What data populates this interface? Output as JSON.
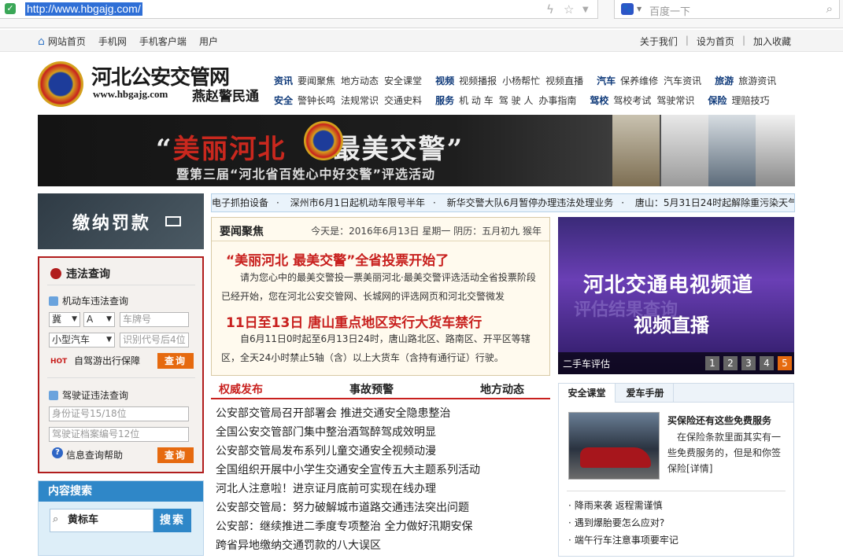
{
  "browser": {
    "url": "http://www.hbgajg.com/",
    "search_placeholder": "百度一下"
  },
  "topnav": {
    "left": [
      "网站首页",
      "手机网",
      "手机客户端",
      "用户"
    ],
    "right": [
      "关于我们",
      "设为首页",
      "加入收藏"
    ],
    "sep": "|"
  },
  "header": {
    "title": "河北公安交管网",
    "url": "www.hbgajg.com",
    "brand": "燕赵警民通",
    "nav": {
      "row1": [
        {
          "cat": "资讯",
          "items": [
            "要闻聚焦",
            "地方动态",
            "安全课堂"
          ]
        },
        {
          "cat": "视频",
          "items": [
            "视频播报",
            "小杨帮忙",
            "视频直播"
          ]
        },
        {
          "cat": "汽车",
          "items": [
            "保养维修",
            "汽车资讯"
          ]
        },
        {
          "cat": "旅游",
          "items": [
            "旅游资讯"
          ]
        }
      ],
      "row2": [
        {
          "cat": "安全",
          "items": [
            "警钟长鸣",
            "法规常识",
            "交通史料"
          ]
        },
        {
          "cat": "服务",
          "items": [
            "机 动 车",
            "驾 驶 人",
            "办事指南"
          ]
        },
        {
          "cat": "驾校",
          "items": [
            "驾校考试",
            "驾驶常识"
          ]
        },
        {
          "cat": "保险",
          "items": [
            "理赔技巧"
          ]
        }
      ]
    }
  },
  "banner": {
    "left_quote": "“",
    "red_text": "美丽河北",
    "white_text": "最美交警",
    "right_quote": "”",
    "subtitle": "暨第三届“河北省百姓心中好交警”评选活动"
  },
  "left": {
    "fines_label": "缴纳罚款",
    "violation_title": "违法查询",
    "vehicle_label": "机动车违法查询",
    "province": "冀",
    "letter": "A",
    "plate_placeholder": "车牌号",
    "car_type": "小型汽车",
    "vin_placeholder": "识别代号后4位",
    "hot_tag": "HOT",
    "selfdrive": "自驾游出行保障",
    "query_btn": "查询",
    "license_label": "驾驶证违法查询",
    "id_placeholder": "身份证号15/18位",
    "file_placeholder": "驾驶证档案编号12位",
    "help": "信息查询帮助",
    "help_icon": "?",
    "search_title": "内容搜索",
    "search_value": "黄标车",
    "search_btn": "搜索"
  },
  "ticker": [
    "电子抓拍设备",
    "深州市6月1日起机动车限号半年",
    "新华交警大队6月暂停办理违法处理业务",
    "唐山：5月31日24时起解除重污染天气三"
  ],
  "news": {
    "title": "要闻聚焦",
    "date": "今天是：2016年6月13日  星期一  阴历：五月初九  猴年",
    "headline1": "“美丽河北  最美交警”全省投票开始了",
    "para1": "请为您心中的最美交警投一票美丽河北·最美交警评选活动全省投票阶段已经开始，您在河北公安交管网、长城网的评选网页和河北交警微发",
    "headline2": "11日至13日  唐山重点地区实行大货车禁行",
    "para2": "自6月11日0时起至6月13日24时，唐山路北区、路南区、开平区等辖区，全天24小时禁止5轴（含）以上大货车（含持有通行证）行驶。"
  },
  "tabs": [
    "权威发布",
    "事故预警",
    "地方动态"
  ],
  "list": [
    "公安部交管局召开部署会  推进交通安全隐患整治",
    "全国公安交管部门集中整治酒驾醉驾成效明显",
    "公安部交管局发布系列儿童交通安全视频动漫",
    "全国组织开展中小学生交通安全宣传五大主题系列活动",
    "河北人注意啦！进京证月底前可实现在线办理",
    "公安部交管局：努力破解城市道路交通违法突出问题",
    "公安部：继续推进二季度专项整治  全力做好汛期安保",
    "跨省异地缴纳交通罚款的八大误区"
  ],
  "video": {
    "title": "河北交通电视频道",
    "shadow": "评估结果查询",
    "sub": "视频直播",
    "caption": "二手车评估",
    "pages": [
      "1",
      "2",
      "3",
      "4",
      "5"
    ],
    "active_page": 5
  },
  "rtabs": {
    "tabs": [
      "安全课堂",
      "爱车手册"
    ],
    "card_title": "买保险还有这些免费服务",
    "card_desc": "在保险条款里面其实有一些免费服务的，但是和你签保险",
    "card_more": "[详情]",
    "list": [
      "降雨来袭  返程需谨慎",
      "遇到爆胎要怎么应对?",
      "端午行车注意事项要牢记"
    ]
  },
  "colors": {
    "accent_red": "#c8201e",
    "nav_blue": "#0f3a7a",
    "button_orange": "#e66a0f",
    "search_blue": "#2f87c8"
  }
}
